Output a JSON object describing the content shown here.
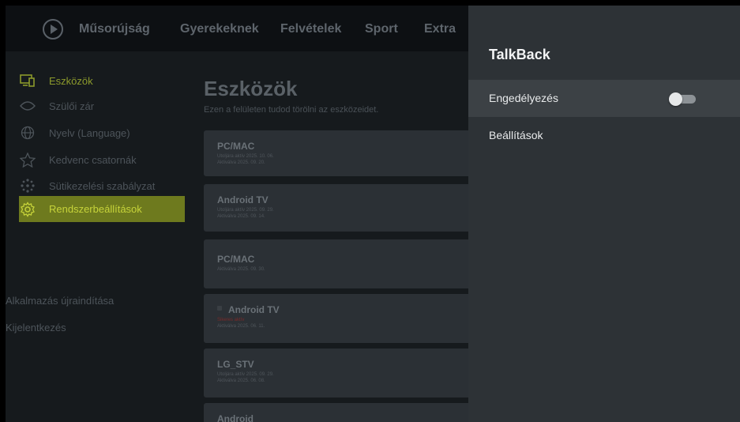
{
  "nav": {
    "items": [
      "Műsorújság",
      "Gyerekeknek",
      "Felvételek",
      "Sport",
      "Extra"
    ]
  },
  "sidebar": {
    "items": [
      {
        "label": "Eszközök",
        "icon": "devices-icon"
      },
      {
        "label": "Szülői zár",
        "icon": "eye-icon"
      },
      {
        "label": "Nyelv (Language)",
        "icon": "globe-icon"
      },
      {
        "label": "Kedvenc csatornák",
        "icon": "star-icon"
      },
      {
        "label": "Sütikezelési szabályzat",
        "icon": "cookie-icon"
      },
      {
        "label": "Rendszerbeállítások",
        "icon": "gear-icon"
      }
    ],
    "restart": "Alkalmazás újraindítása",
    "logout": "Kijelentkezés"
  },
  "main": {
    "title": "Eszközök",
    "subtitle": "Ezen a felületen tudod törölni az eszközeidet.",
    "devices": [
      {
        "name": "PC/MAC",
        "line1": "Utoljára aktív 2025. 10. 06.",
        "line2": "Aktiválva 2025. 09. 20."
      },
      {
        "name": "Android TV",
        "line1": "Utoljára aktív 2025. 09. 29.",
        "line2": "Aktiválva 2025. 09. 14."
      },
      {
        "name": "PC/MAC",
        "line1": "Aktiválva 2025. 09. 30.",
        "line2": ""
      },
      {
        "name": "Android TV",
        "line1": "Sikeres aktív",
        "line2": "Aktiválva 2025. 06. 11."
      },
      {
        "name": "LG_STV",
        "line1": "Utoljára aktív 2025. 09. 29.",
        "line2": "Aktiválva 2025. 06. 08."
      },
      {
        "name": "Android",
        "line1": "",
        "line2": ""
      }
    ]
  },
  "panel": {
    "title": "TalkBack",
    "enable_label": "Engedélyezés",
    "enable_state": "off",
    "settings_label": "Beállítások"
  }
}
